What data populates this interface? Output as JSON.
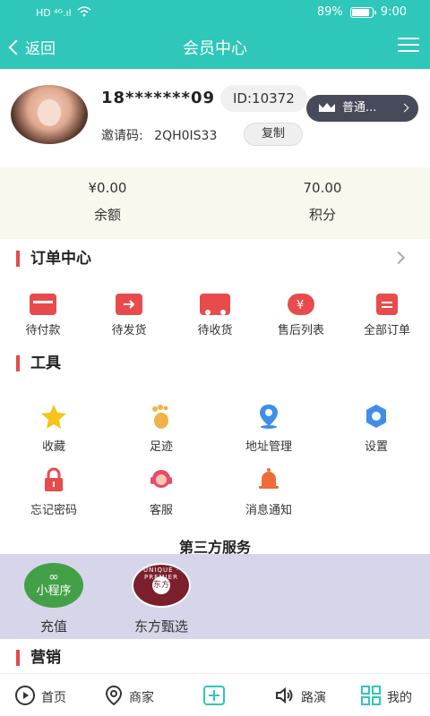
{
  "status_bar": {
    "network": "HD ⁴ᴳ.ıl",
    "wifi_icon": "wifi-icon",
    "battery": "89%",
    "battery_level": 0.89,
    "time": "9:00"
  },
  "navbar": {
    "back_label": "返回",
    "title": "会员中心",
    "menu_icon": "hamburger-menu-icon"
  },
  "profile": {
    "phone": "18*******09",
    "id": "ID:10372",
    "level": "普通...",
    "invite_label": "邀请码:",
    "invite_code": "2QH0IS33",
    "copy_label": "复制"
  },
  "balance": [
    {
      "value": "¥0.00",
      "label": "余额"
    },
    {
      "value": "70.00",
      "label": "积分"
    }
  ],
  "orders": {
    "title": "订单中心",
    "items": [
      {
        "label": "待付款",
        "icon": "wallet-icon"
      },
      {
        "label": "待发货",
        "icon": "package-icon"
      },
      {
        "label": "待收货",
        "icon": "truck-icon"
      },
      {
        "label": "售后列表",
        "icon": "refund-icon"
      },
      {
        "label": "全部订单",
        "icon": "clipboard-icon"
      }
    ]
  },
  "tools": {
    "title": "工具",
    "items": [
      {
        "label": "收藏",
        "icon": "star-icon",
        "color": "#f5c518"
      },
      {
        "label": "足迹",
        "icon": "footprint-icon",
        "color": "#f0b24a"
      },
      {
        "label": "地址管理",
        "icon": "location-pin-icon",
        "color": "#3f8ee8"
      },
      {
        "label": "设置",
        "icon": "gear-icon",
        "color": "#3f8ee8"
      },
      {
        "label": "忘记密码",
        "icon": "lock-icon",
        "color": "#e84b4b"
      },
      {
        "label": "客服",
        "icon": "customer-service-icon",
        "color": "#e84b6a"
      },
      {
        "label": "消息通知",
        "icon": "bell-icon",
        "color": "#f06a3a"
      }
    ]
  },
  "third_party": {
    "title": "第三方服务",
    "items": [
      {
        "label": "充值",
        "badge": "小程序",
        "icon": "mini-program-icon"
      },
      {
        "label": "东方甄选",
        "icon": "dongfang-zhenxuan-logo"
      }
    ]
  },
  "marketing": {
    "title": "营销"
  },
  "tabbar": [
    {
      "label": "首页",
      "icon": "play-home-icon"
    },
    {
      "label": "商家",
      "icon": "map-pin-icon"
    },
    {
      "label": "",
      "icon": "add-icon"
    },
    {
      "label": "路演",
      "icon": "speaker-icon"
    },
    {
      "label": "我的",
      "icon": "grid-icon"
    }
  ],
  "colors": {
    "header": "#2ec7b9",
    "accent_red": "#e84b4b",
    "level_badge": "#474a5a",
    "third_bg": "#d6d5ea",
    "balance_bg": "#f8f8ef"
  }
}
